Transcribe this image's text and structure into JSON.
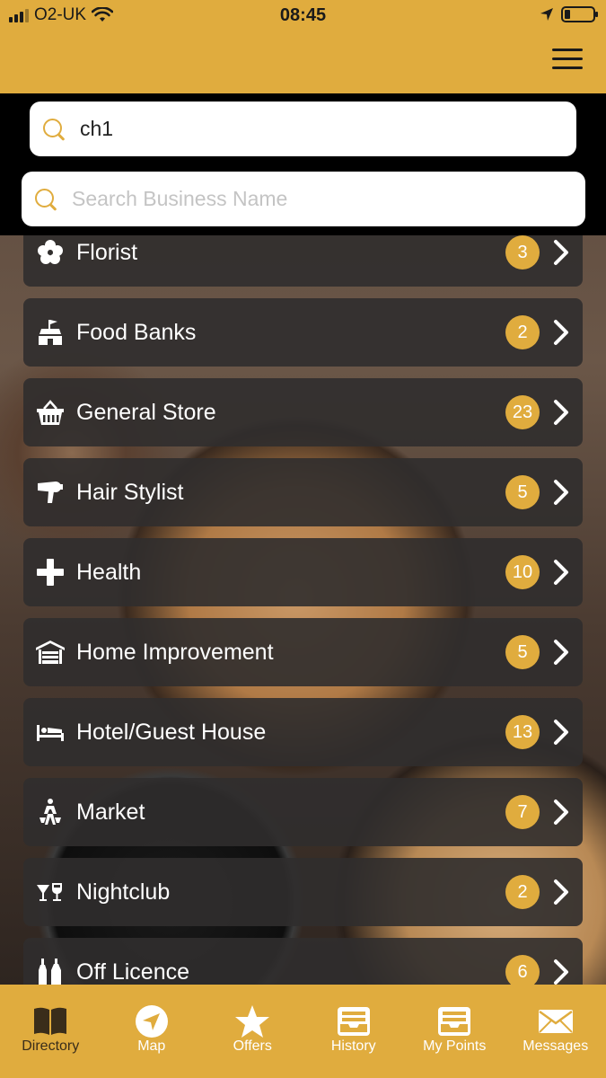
{
  "status_bar": {
    "carrier": "O2-UK",
    "time": "08:45"
  },
  "search": {
    "location_value": "ch1",
    "business_placeholder": "Search Business Name"
  },
  "categories": [
    {
      "label": "Florist",
      "count": "3",
      "icon": "flower-icon"
    },
    {
      "label": "Food Banks",
      "count": "2",
      "icon": "food-bank-icon"
    },
    {
      "label": "General Store",
      "count": "23",
      "icon": "basket-icon"
    },
    {
      "label": "Hair Stylist",
      "count": "5",
      "icon": "hair-dryer-icon"
    },
    {
      "label": "Health",
      "count": "10",
      "icon": "plus-icon"
    },
    {
      "label": "Home Improvement",
      "count": "5",
      "icon": "garage-icon"
    },
    {
      "label": "Hotel/Guest House",
      "count": "13",
      "icon": "bed-icon"
    },
    {
      "label": "Market",
      "count": "7",
      "icon": "market-icon"
    },
    {
      "label": "Nightclub",
      "count": "2",
      "icon": "glasses-icon"
    },
    {
      "label": "Off Licence",
      "count": "6",
      "icon": "bottles-icon"
    }
  ],
  "tabs": [
    {
      "label": "Directory",
      "icon": "book-icon"
    },
    {
      "label": "Map",
      "icon": "navigation-icon"
    },
    {
      "label": "Offers",
      "icon": "star-icon"
    },
    {
      "label": "History",
      "icon": "tray-icon"
    },
    {
      "label": "My Points",
      "icon": "tray-icon"
    },
    {
      "label": "Messages",
      "icon": "envelope-icon"
    }
  ],
  "colors": {
    "accent": "#e0ac3e",
    "row_background": "#302e2d"
  }
}
